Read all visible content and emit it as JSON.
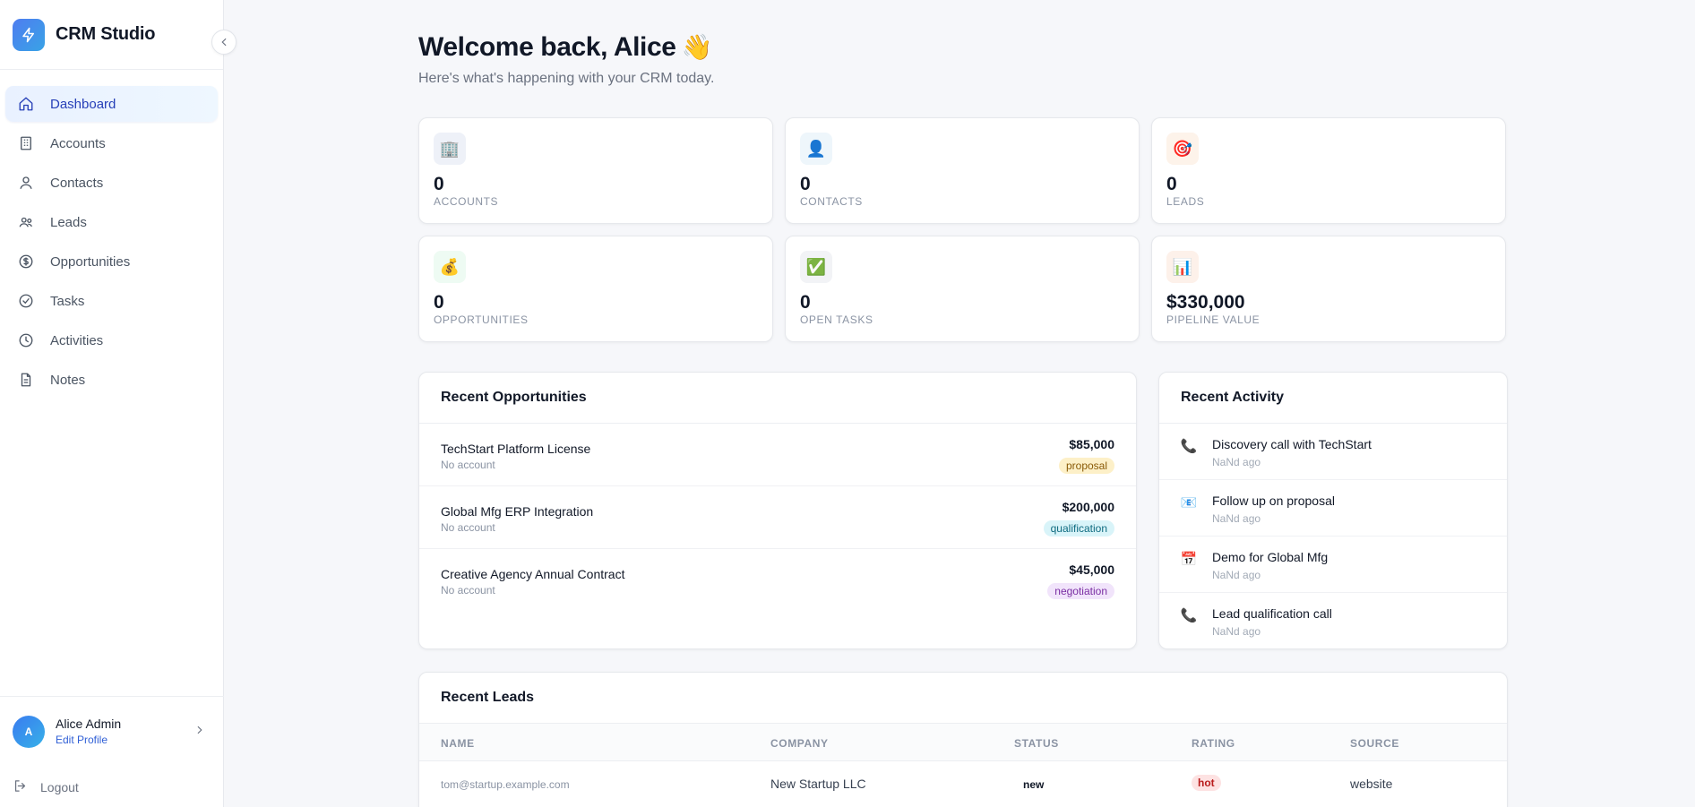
{
  "app": {
    "name": "CRM Studio"
  },
  "sidebar": {
    "items": [
      {
        "label": "Dashboard",
        "icon": "home-icon",
        "active": true
      },
      {
        "label": "Accounts",
        "icon": "building-icon"
      },
      {
        "label": "Contacts",
        "icon": "user-icon"
      },
      {
        "label": "Leads",
        "icon": "users-icon"
      },
      {
        "label": "Opportunities",
        "icon": "dollar-icon"
      },
      {
        "label": "Tasks",
        "icon": "check-circle-icon"
      },
      {
        "label": "Activities",
        "icon": "clock-icon"
      },
      {
        "label": "Notes",
        "icon": "file-icon"
      }
    ],
    "user": {
      "initial": "A",
      "name": "Alice Admin",
      "edit_label": "Edit Profile"
    },
    "logout_label": "Logout"
  },
  "header": {
    "welcome": "Welcome back, Alice",
    "wave": "👋",
    "subtitle": "Here's what's happening with your CRM today."
  },
  "stats": [
    {
      "icon": "🏢",
      "value": "0",
      "label": "ACCOUNTS",
      "bg": "#eef1f8"
    },
    {
      "icon": "👤",
      "value": "0",
      "label": "CONTACTS",
      "bg": "#eef6fb"
    },
    {
      "icon": "🎯",
      "value": "0",
      "label": "LEADS",
      "bg": "#fdf3ea"
    },
    {
      "icon": "💰",
      "value": "0",
      "label": "OPPORTUNITIES",
      "bg": "#eefbf3"
    },
    {
      "icon": "✅",
      "value": "0",
      "label": "OPEN TASKS",
      "bg": "#f2f3f6"
    },
    {
      "icon": "📊",
      "value": "$330,000",
      "label": "PIPELINE VALUE",
      "bg": "#fdf1ea"
    }
  ],
  "opportunities": {
    "title": "Recent Opportunities",
    "rows": [
      {
        "name": "TechStart Platform License",
        "account": "No account",
        "amount": "$85,000",
        "stage": "proposal",
        "badge_bg": "#fdf0c8",
        "badge_fg": "#8a5a07"
      },
      {
        "name": "Global Mfg ERP Integration",
        "account": "No account",
        "amount": "$200,000",
        "stage": "qualification",
        "badge_bg": "#d9f4f9",
        "badge_fg": "#0e6b80"
      },
      {
        "name": "Creative Agency Annual Contract",
        "account": "No account",
        "amount": "$45,000",
        "stage": "negotiation",
        "badge_bg": "#f1e4fb",
        "badge_fg": "#7a2ea3"
      }
    ]
  },
  "activity": {
    "title": "Recent Activity",
    "rows": [
      {
        "icon": "📞",
        "title": "Discovery call with TechStart",
        "time": "NaNd ago"
      },
      {
        "icon": "📧",
        "title": "Follow up on proposal",
        "time": "NaNd ago"
      },
      {
        "icon": "📅",
        "title": "Demo for Global Mfg",
        "time": "NaNd ago"
      },
      {
        "icon": "📞",
        "title": "Lead qualification call",
        "time": "NaNd ago"
      }
    ]
  },
  "leads": {
    "title": "Recent Leads",
    "columns": [
      "NAME",
      "COMPANY",
      "STATUS",
      "RATING",
      "SOURCE"
    ],
    "rows": [
      {
        "name": "tom@startup.example.com",
        "company": "New Startup LLC",
        "status": "new",
        "rating": "hot",
        "source": "website"
      }
    ]
  },
  "colors": {
    "accent": "#2740b8",
    "brand_gradient_start": "#4f7df0",
    "brand_gradient_end": "#38a3e6"
  }
}
